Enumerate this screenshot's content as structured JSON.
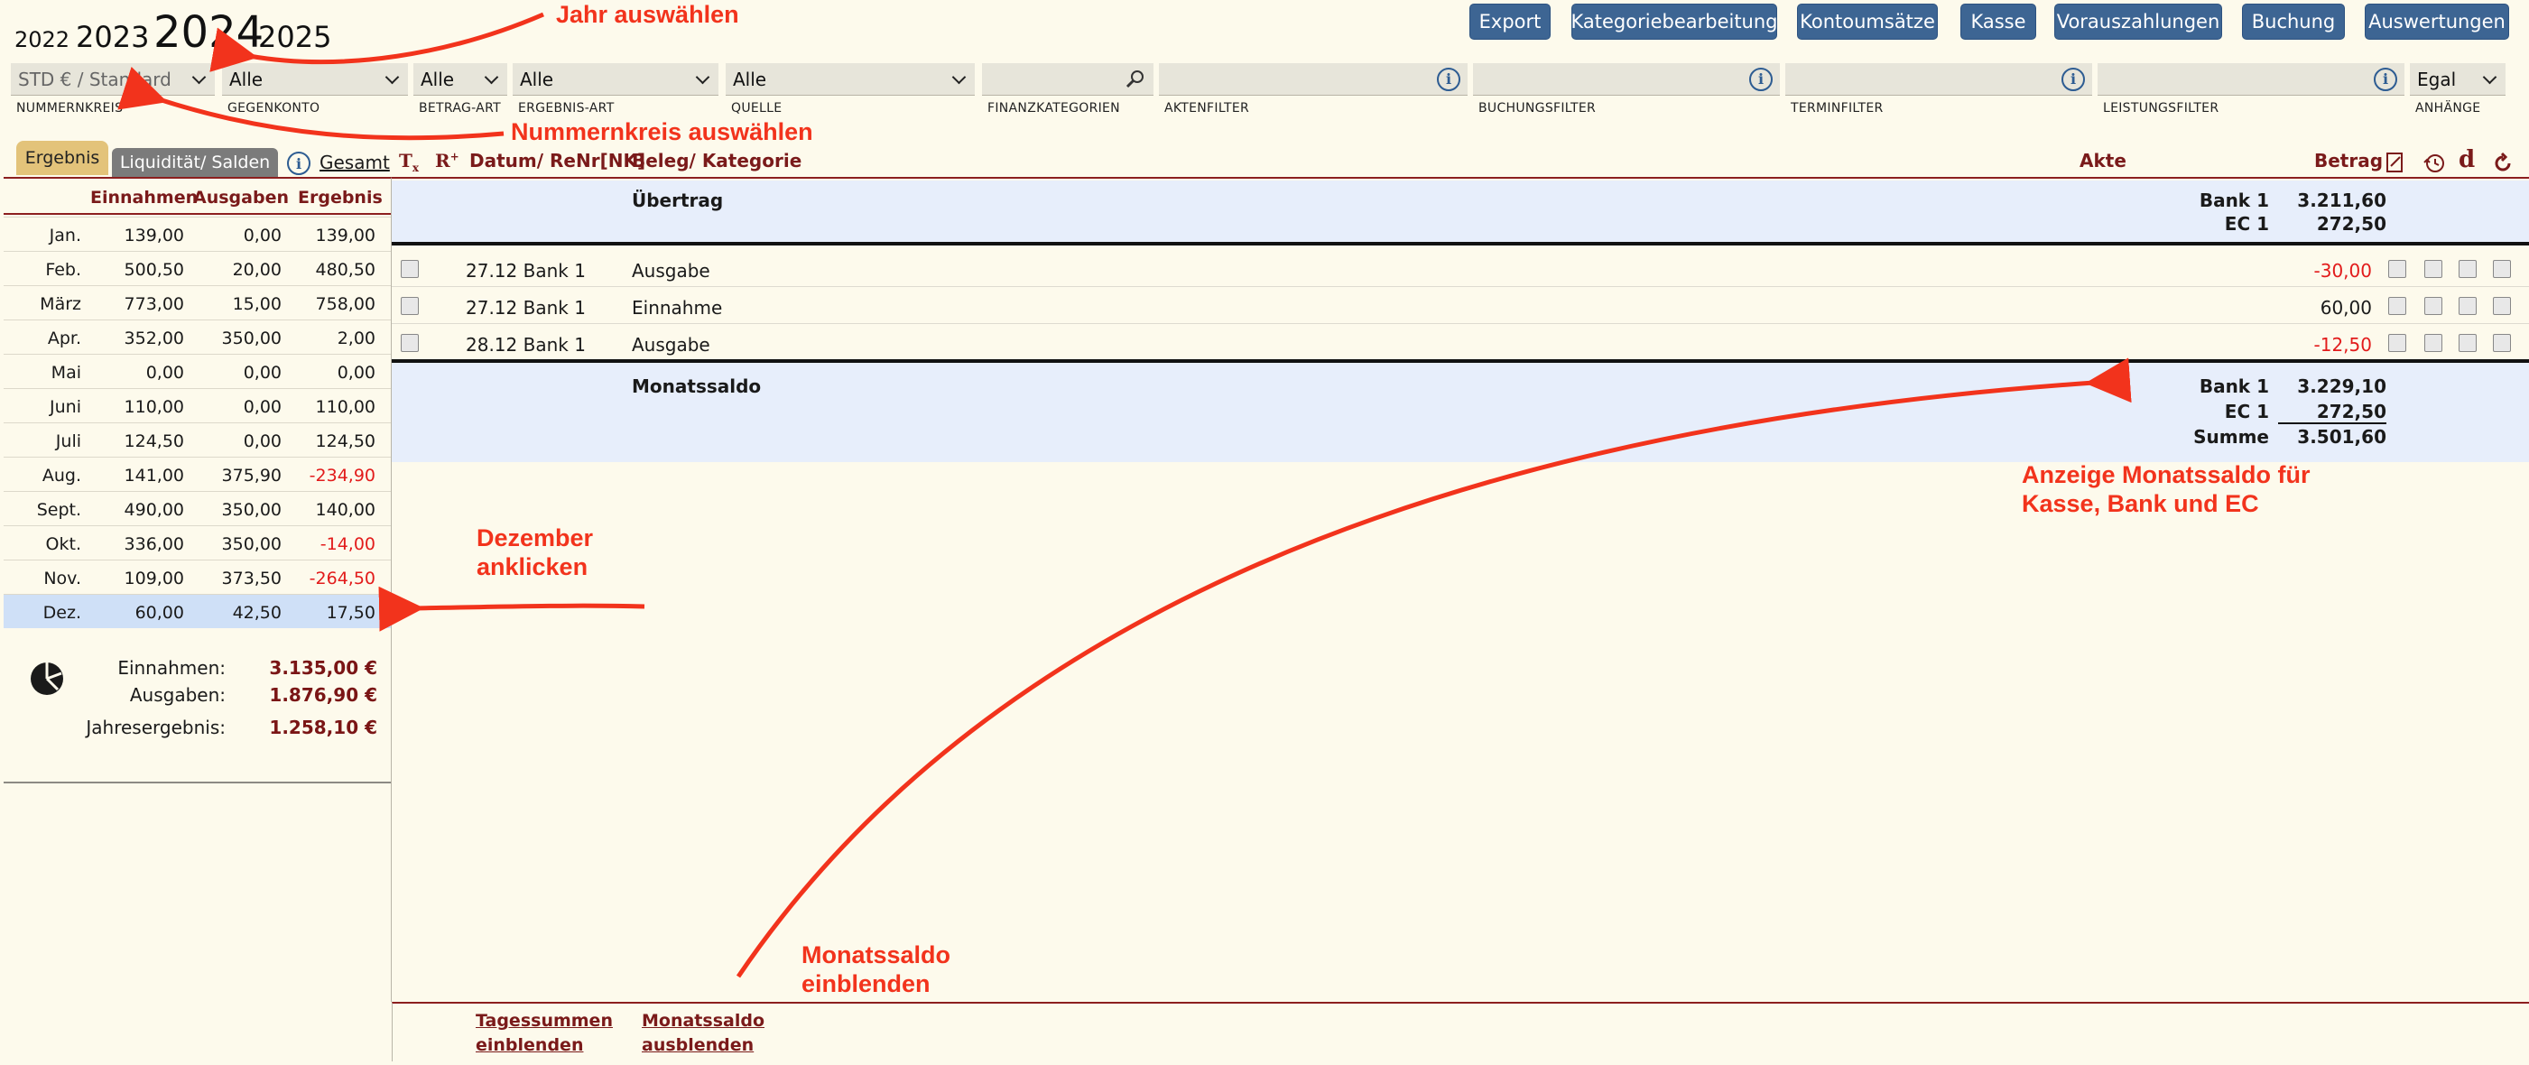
{
  "years": {
    "y2022": "2022",
    "y2023": "2023",
    "y2024": "2024",
    "y2025": "2025"
  },
  "toolbar": {
    "export": "Export",
    "kategorie": "Kategoriebearbeitung",
    "kontoumsaetze": "Kontoumsätze",
    "kasse": "Kasse",
    "vorauszahlungen": "Vorauszahlungen",
    "buchung": "Buchung",
    "auswertungen": "Auswertungen"
  },
  "filters": {
    "nummernkreis": {
      "value": "STD € / Standard",
      "label": "NUMMERNKREIS"
    },
    "gegenkonto": {
      "value": "Alle",
      "label": "GEGENKONTO"
    },
    "betragart": {
      "value": "Alle",
      "label": "BETRAG-ART"
    },
    "ergebnisart": {
      "value": "Alle",
      "label": "ERGEBNIS-ART"
    },
    "quelle": {
      "value": "Alle",
      "label": "QUELLE"
    },
    "finanzkategorien": {
      "value": "",
      "label": "FINANZKATEGORIEN"
    },
    "aktenfilter": {
      "value": "",
      "label": "AKTENFILTER"
    },
    "buchungsfilter": {
      "value": "",
      "label": "BUCHUNGSFILTER"
    },
    "terminfilter": {
      "value": "",
      "label": "TERMINFILTER"
    },
    "leistungsfilter": {
      "value": "",
      "label": "LEISTUNGSFILTER"
    },
    "anhaenge": {
      "value": "Egal",
      "label": "ANHÄNGE"
    }
  },
  "tabs": {
    "ergebnis": "Ergebnis",
    "liquiditaet": "Liquidität/ Salden",
    "gesamt": "Gesamt"
  },
  "months_head": {
    "einnahmen": "Einnahmen",
    "ausgaben": "Ausgaben",
    "ergebnis": "Ergebnis"
  },
  "months": [
    {
      "name": "Jan.",
      "ein": "139,00",
      "aus": "0,00",
      "erg": "139,00"
    },
    {
      "name": "Feb.",
      "ein": "500,50",
      "aus": "20,00",
      "erg": "480,50"
    },
    {
      "name": "März",
      "ein": "773,00",
      "aus": "15,00",
      "erg": "758,00"
    },
    {
      "name": "Apr.",
      "ein": "352,00",
      "aus": "350,00",
      "erg": "2,00"
    },
    {
      "name": "Mai",
      "ein": "0,00",
      "aus": "0,00",
      "erg": "0,00"
    },
    {
      "name": "Juni",
      "ein": "110,00",
      "aus": "0,00",
      "erg": "110,00"
    },
    {
      "name": "Juli",
      "ein": "124,50",
      "aus": "0,00",
      "erg": "124,50"
    },
    {
      "name": "Aug.",
      "ein": "141,00",
      "aus": "375,90",
      "erg": "-234,90"
    },
    {
      "name": "Sept.",
      "ein": "490,00",
      "aus": "350,00",
      "erg": "140,00"
    },
    {
      "name": "Okt.",
      "ein": "336,00",
      "aus": "350,00",
      "erg": "-14,00"
    },
    {
      "name": "Nov.",
      "ein": "109,00",
      "aus": "373,50",
      "erg": "-264,50"
    },
    {
      "name": "Dez.",
      "ein": "60,00",
      "aus": "42,50",
      "erg": "17,50"
    }
  ],
  "summary": {
    "einnahmen_label": "Einnahmen:",
    "einnahmen": "3.135,00 €",
    "ausgaben_label": "Ausgaben:",
    "ausgaben": "1.876,90 €",
    "jahres_label": "Jahresergebnis:",
    "jahres": "1.258,10 €"
  },
  "table_head": {
    "datum": "Datum/ ReNr[NK]",
    "beleg": "Beleg/ Kategorie",
    "akte": "Akte",
    "betrag": "Betrag"
  },
  "uebertrag": {
    "label": "Übertrag",
    "bank_label": "Bank 1",
    "bank": "3.211,60",
    "ec_label": "EC 1",
    "ec": "272,50"
  },
  "rows": [
    {
      "datum": "27.12 Bank 1",
      "beleg": "Ausgabe",
      "betrag": "-30,00"
    },
    {
      "datum": "27.12 Bank 1",
      "beleg": "Einnahme",
      "betrag": "60,00"
    },
    {
      "datum": "28.12 Bank 1",
      "beleg": "Ausgabe",
      "betrag": "-12,50"
    }
  ],
  "monatssaldo": {
    "label": "Monatssaldo",
    "bank_label": "Bank 1",
    "bank": "3.229,10",
    "ec_label": "EC 1",
    "ec": "272,50",
    "summe_label": "Summe",
    "summe": "3.501,60"
  },
  "bottom": {
    "tagessummen_1": "Tagessummen",
    "tagessummen_2": "einblenden",
    "monatssaldo_1": "Monatssaldo",
    "monatssaldo_2": "ausblenden"
  },
  "annotations": {
    "jahr": "Jahr auswählen",
    "nummernkreis": "Nummernkreis auswählen",
    "dezember_1": "Dezember",
    "dezember_2": "anklicken",
    "anzeige_1": "Anzeige Monatssaldo für",
    "anzeige_2": "Kasse, Bank und EC",
    "einblenden_1": "Monatssaldo",
    "einblenden_2": "einblenden"
  },
  "colors": {
    "accent": "#3d6593",
    "header": "#7a1a1a",
    "negative": "#e21b1b",
    "annotation": "#f2331c",
    "highlight": "#cfe0f7"
  }
}
